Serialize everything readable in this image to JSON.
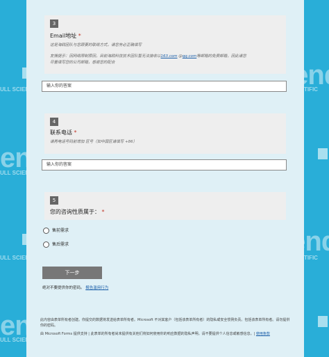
{
  "background": {
    "brand": "BarTender",
    "tagline": "BY SEAGULL SCIENTIFIC",
    "tagline_partial": "ULL SCIENTIFIC",
    "brand_partial": "ender",
    "color": "#29aed8"
  },
  "questions": [
    {
      "number": "3",
      "title": "Email地址",
      "required_mark": "*",
      "hint1": "这是海鸥团队与您跟要的联络方式，请您务必正确填写",
      "hint2_pre": "友情提示：因网络限制原因，目前海鸥科技技术团队暂无法接收以",
      "hint2_link1": "163.com",
      "hint2_mid": " @",
      "hint2_link2": "qq.com",
      "hint2_post": "等邮箱的免费邮箱，因此请您",
      "hint3": "尽量填写您的公司邮箱，感谢您的配合",
      "placeholder": "输入你的答案"
    },
    {
      "number": "4",
      "title": "联系电话",
      "required_mark": "*",
      "hint1": "请再电话号码前增加 区号（如中国区请填写 +86）",
      "placeholder": "输入你的答案"
    },
    {
      "number": "5",
      "title": "您的咨询性质属于：",
      "required_mark": "*",
      "options": [
        "售前需求",
        "售后需求"
      ]
    }
  ],
  "next_button": "下一步",
  "never_text": "绝对不要提供你的密码。",
  "report_link": "报告滥用行为",
  "footer_line1": "此内容由表单所有者创建。你提交的数据将发送给表单所有者。Microsoft 不对其客户（包括该表单所有者）的隐私或安全惯例负责。包括该表单所有者。请勿提供你的密码。",
  "footer_line2": "由 Microsoft Forms 提供支持 | 此表单的所有者尚未提供有关他们将如何使用你的响应数据的隐私声明。请不要提供个人信息或敏感信息。|",
  "footer_terms": "使用条款"
}
